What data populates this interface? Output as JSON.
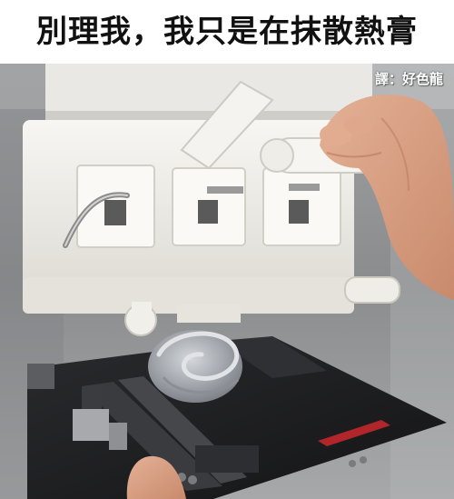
{
  "caption": {
    "text": "別理我，我只是在抹散熱膏"
  },
  "watermark": {
    "text": "譯：好色龍"
  },
  "colors": {
    "background": "#ffffff",
    "caption_text": "#111111",
    "machine_white": "#f2f0ea",
    "board_black": "#1c1c1e",
    "thermal_paste_grey": "#a9adb3",
    "skin": "#d9a082"
  }
}
